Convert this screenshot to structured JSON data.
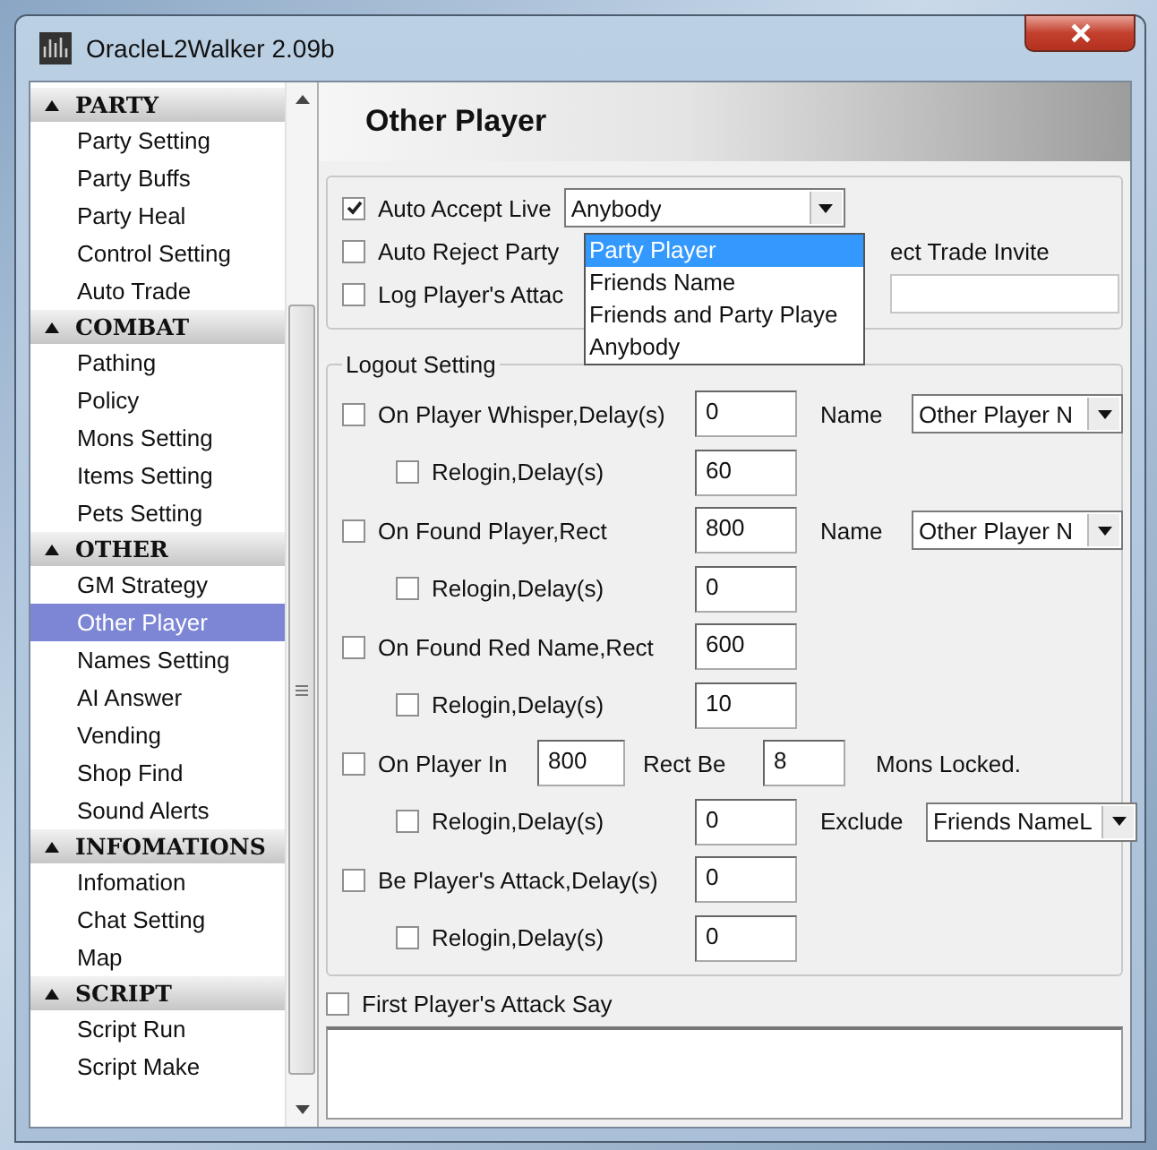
{
  "window": {
    "title": "OracleL2Walker 2.09b"
  },
  "sidebar": {
    "sections": [
      {
        "title": "PARTY",
        "expanded": true,
        "items": [
          {
            "label": "Party Setting",
            "selected": false
          },
          {
            "label": "Party Buffs",
            "selected": false
          },
          {
            "label": "Party Heal",
            "selected": false
          },
          {
            "label": "Control Setting",
            "selected": false
          },
          {
            "label": "Auto Trade",
            "selected": false
          }
        ]
      },
      {
        "title": "COMBAT",
        "expanded": true,
        "items": [
          {
            "label": "Pathing",
            "selected": false
          },
          {
            "label": "Policy",
            "selected": false
          },
          {
            "label": "Mons Setting",
            "selected": false
          },
          {
            "label": "Items Setting",
            "selected": false
          },
          {
            "label": "Pets Setting",
            "selected": false
          }
        ]
      },
      {
        "title": "OTHER",
        "expanded": true,
        "items": [
          {
            "label": "GM Strategy",
            "selected": false
          },
          {
            "label": "Other Player",
            "selected": true
          },
          {
            "label": "Names Setting",
            "selected": false
          },
          {
            "label": "AI Answer",
            "selected": false
          },
          {
            "label": "Vending",
            "selected": false
          },
          {
            "label": "Shop Find",
            "selected": false
          },
          {
            "label": "Sound Alerts",
            "selected": false
          }
        ]
      },
      {
        "title": "INFOMATIONS",
        "expanded": true,
        "items": [
          {
            "label": "Infomation",
            "selected": false
          },
          {
            "label": "Chat Setting",
            "selected": false
          },
          {
            "label": "Map",
            "selected": false
          }
        ]
      },
      {
        "title": "SCRIPT",
        "expanded": true,
        "items": [
          {
            "label": "Script Run",
            "selected": false
          },
          {
            "label": "Script Make",
            "selected": false
          }
        ]
      }
    ]
  },
  "header": "Other Player",
  "general": {
    "accept": {
      "checked": true,
      "label": "Auto Accept Live",
      "combo": "Anybody",
      "open": true,
      "options": [
        {
          "label": "Party Player",
          "selected": true
        },
        {
          "label": "Friends Name",
          "selected": false
        },
        {
          "label": "Friends and Party Playe",
          "selected": false
        },
        {
          "label": "Anybody",
          "selected": false
        }
      ]
    },
    "reject": {
      "checked": false,
      "label": "Auto Reject Party",
      "tail": "ect Trade Invite"
    },
    "log": {
      "checked": false,
      "label": "Log Player's Attac"
    }
  },
  "logout": {
    "title": "Logout Setting",
    "rows": [
      {
        "kind": "main",
        "checked": false,
        "label": "On Player Whisper,Delay(s)",
        "value": "0",
        "name_label": "Name",
        "select": "Other Player N"
      },
      {
        "kind": "relogin",
        "checked": false,
        "label": "Relogin,Delay(s)",
        "value": "60"
      },
      {
        "kind": "main",
        "checked": false,
        "label": "On Found Player,Rect",
        "value": "800",
        "name_label": "Name",
        "select": "Other Player N"
      },
      {
        "kind": "relogin",
        "checked": false,
        "label": "Relogin,Delay(s)",
        "value": "0"
      },
      {
        "kind": "main",
        "checked": false,
        "label": "On Found Red Name,Rect",
        "value": "600"
      },
      {
        "kind": "relogin",
        "checked": false,
        "label": "Relogin,Delay(s)",
        "value": "10"
      },
      {
        "kind": "range",
        "checked": false,
        "label": "On Player In",
        "value": "800",
        "mid_label": "Rect Be",
        "value2": "8",
        "end_label": "Mons Locked."
      },
      {
        "kind": "relogin",
        "checked": false,
        "label": "Relogin,Delay(s)",
        "value": "0",
        "name_label": "Exclude",
        "select": "Friends NameL"
      },
      {
        "kind": "main",
        "checked": false,
        "label": "Be Player's Attack,Delay(s)",
        "value": "0"
      },
      {
        "kind": "relogin",
        "checked": false,
        "label": "Relogin,Delay(s)",
        "value": "0"
      }
    ]
  },
  "say": {
    "checked": false,
    "label": "First Player's Attack Say"
  }
}
